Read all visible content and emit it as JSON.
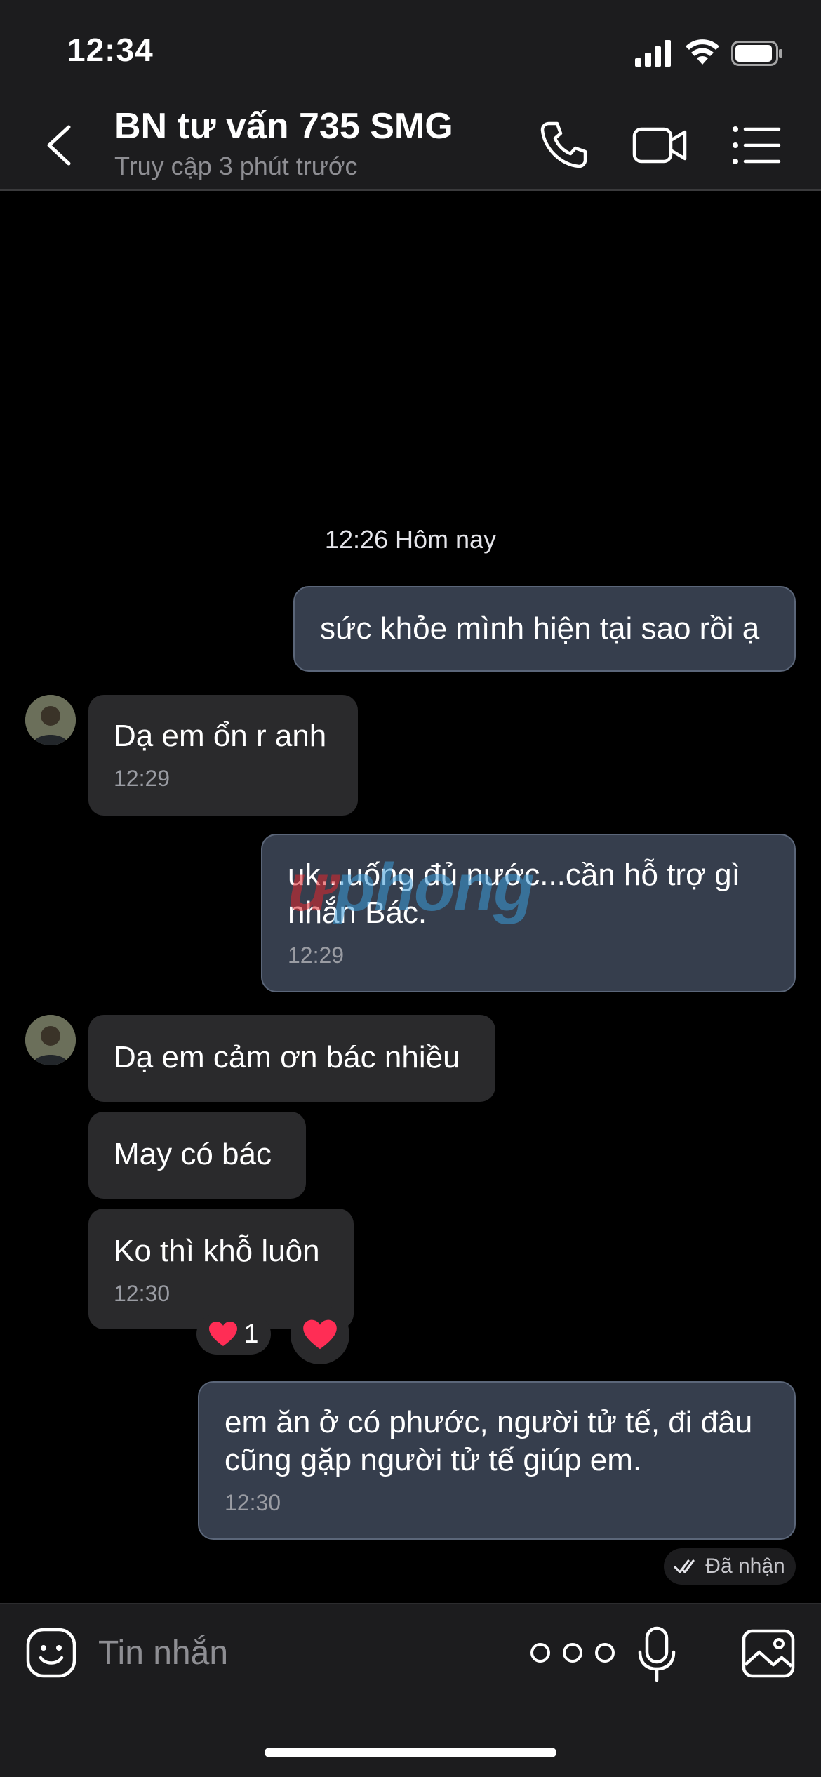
{
  "status_bar": {
    "time": "12:34"
  },
  "header": {
    "title": "BN tư vấn 735 SMG",
    "subtitle": "Truy cập 3 phút trước",
    "icons": [
      "back-icon",
      "phone-icon",
      "video-icon",
      "list-menu-icon"
    ]
  },
  "chat": {
    "date_separator": "12:26 Hôm nay",
    "messages": [
      {
        "side": "sent",
        "text": "sức khỏe mình hiện tại sao rồi ạ",
        "time": ""
      },
      {
        "side": "received",
        "text": "Dạ em ổn r anh",
        "time": "12:29"
      },
      {
        "side": "sent",
        "text": "uk...uống đủ nước...cần hỗ trợ gì nhắn Bác.",
        "time": "12:29"
      },
      {
        "side": "received",
        "text": "Dạ em cảm ơn bác nhiều",
        "time": ""
      },
      {
        "side": "received",
        "text": "May có bác",
        "time": ""
      },
      {
        "side": "received",
        "text": "Ko thì khỗ luôn",
        "time": "12:30"
      },
      {
        "side": "sent",
        "text": "em ăn ở có phước, người tử tế, đi đâu cũng gặp người tử tế giúp em.",
        "time": "12:30"
      }
    ],
    "reaction": {
      "emoji": "❤️",
      "count": "1"
    },
    "delivery_status": "Đã nhận"
  },
  "watermark": {
    "part1": "ư",
    "part2": "phong"
  },
  "input_bar": {
    "placeholder": "Tin nhắn",
    "icons": [
      "emoji-sticker-icon",
      "more-options-icon",
      "microphone-icon",
      "image-gallery-icon"
    ]
  },
  "colors": {
    "sent_bubble": "#363e4d",
    "received_bubble": "#2a2a2c",
    "header_bg": "#1c1c1e",
    "reaction_heart": "#ff2d55"
  }
}
